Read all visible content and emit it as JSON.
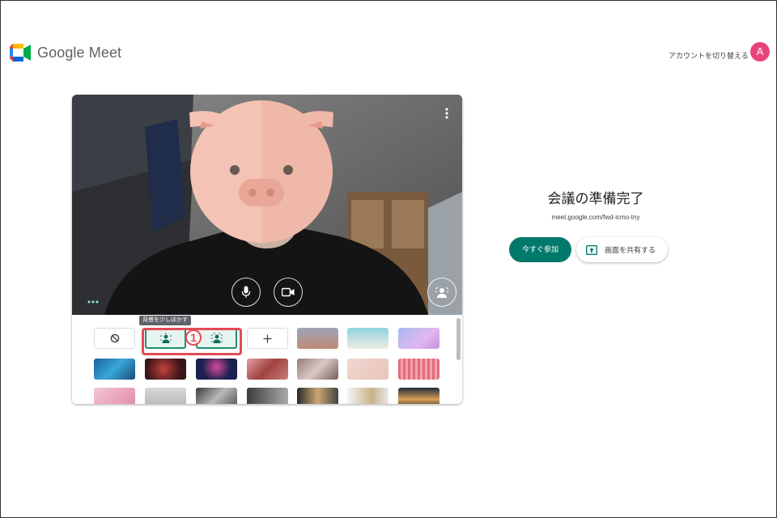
{
  "header": {
    "brand": "Google Meet",
    "switch_account": "アカウントを切り替える",
    "avatar_letter": "A"
  },
  "tray": {
    "tooltip": "背景を少しぼかす",
    "callout_number": "1"
  },
  "side": {
    "title": "会議の準備完了",
    "meeting_url": "meet.google.com/fwd-icmo-tny",
    "join_label": "今すぐ参加",
    "share_label": "画面を共有する"
  },
  "colors": {
    "accent": "#00796b",
    "avatar": "#e8437b",
    "highlight": "#e34b55"
  }
}
